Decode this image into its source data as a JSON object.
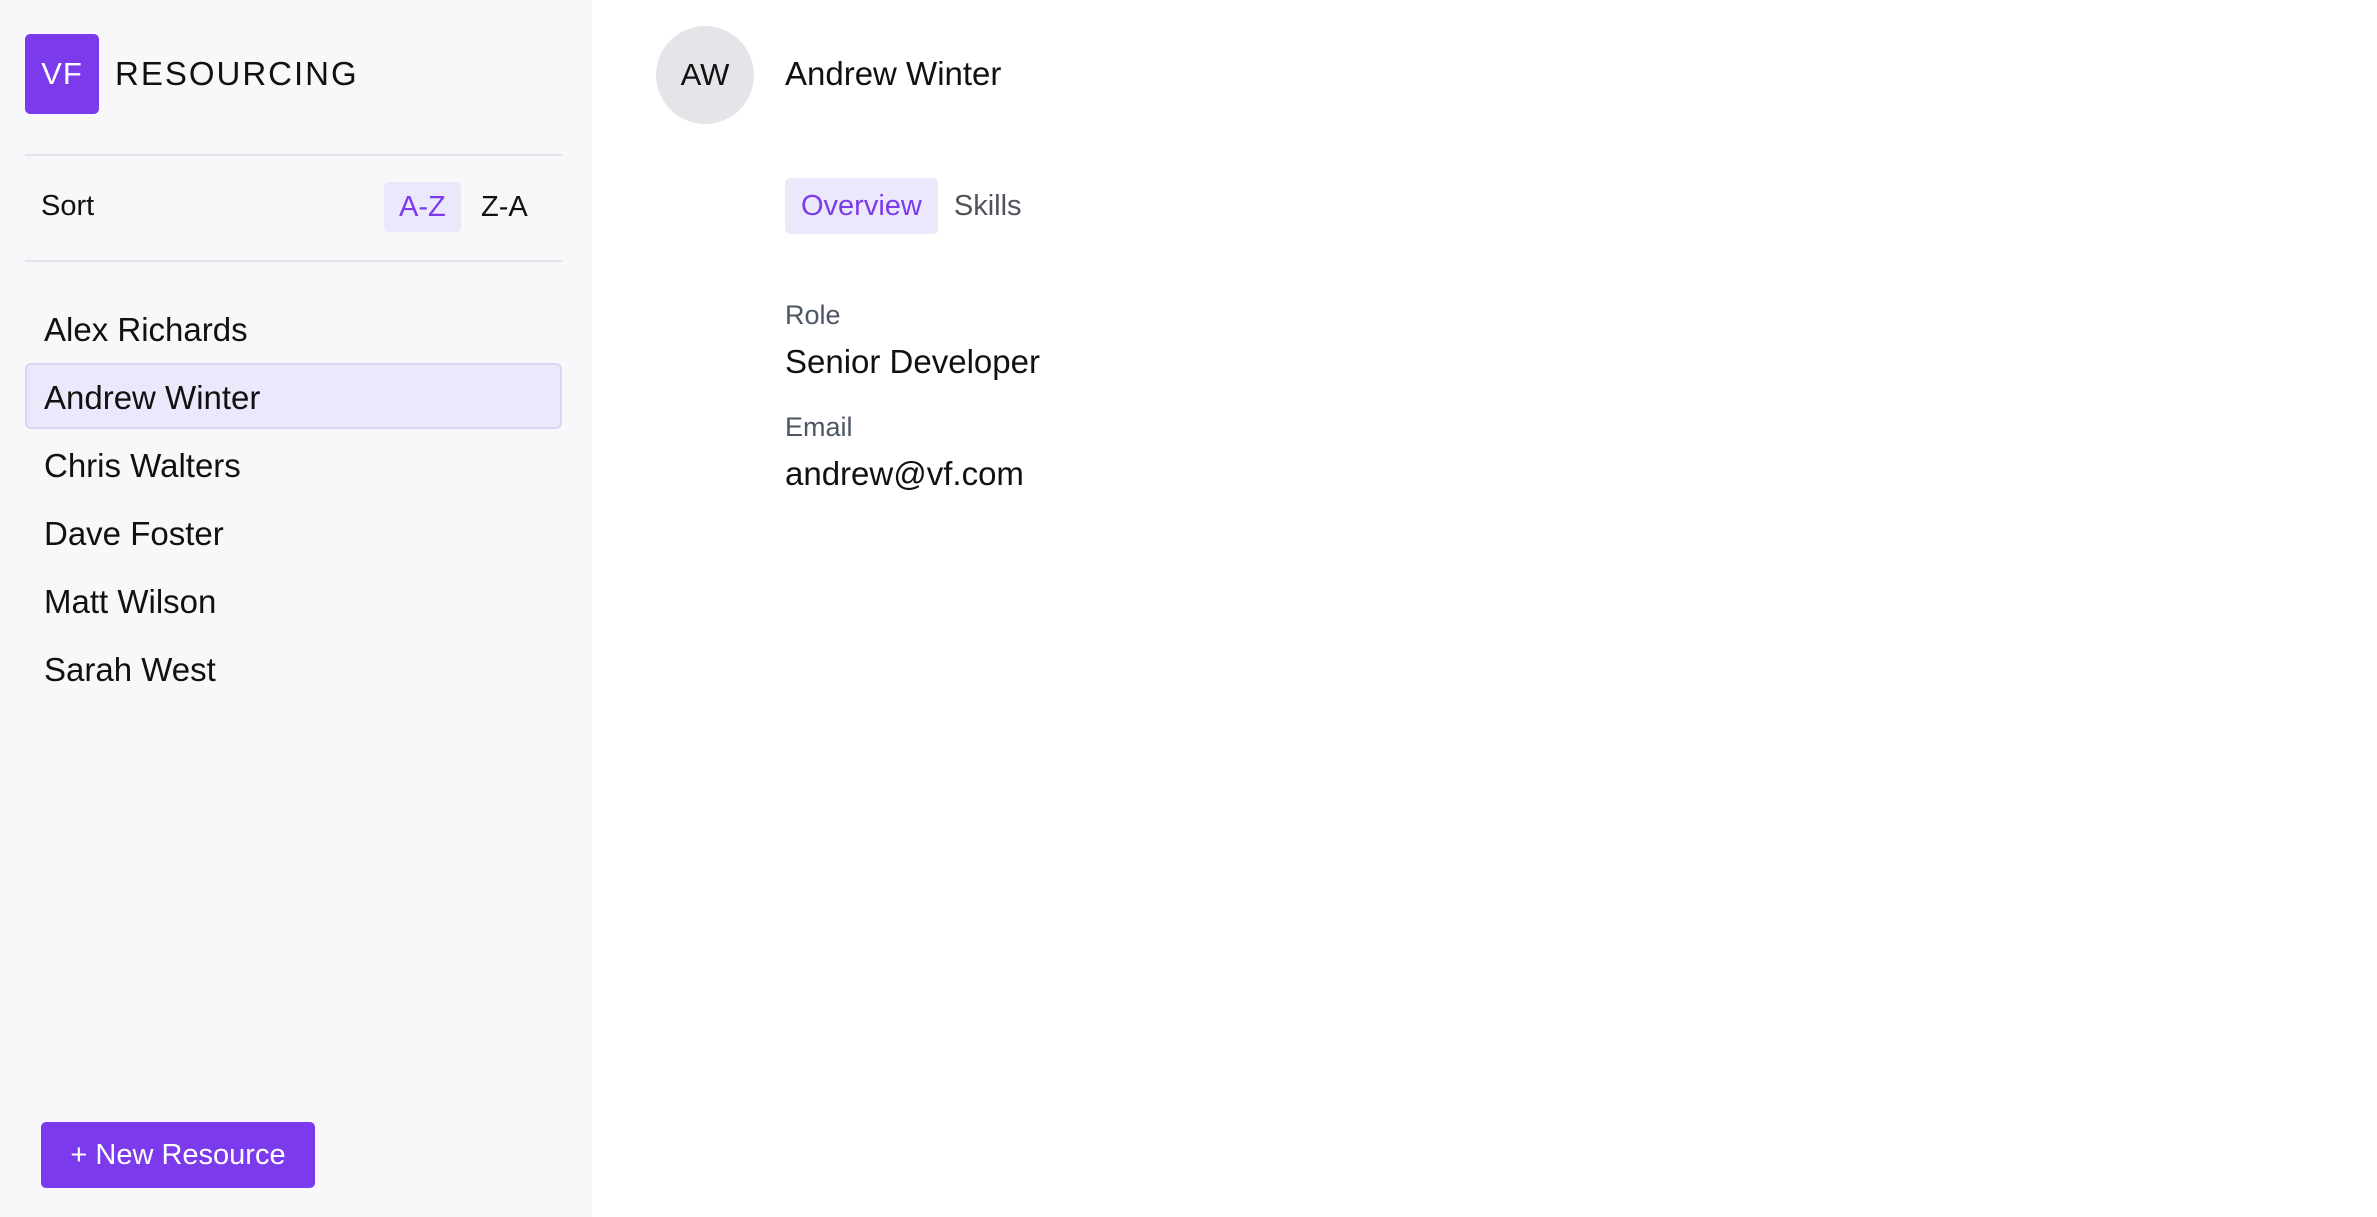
{
  "brand": {
    "logo_text": "VF",
    "title": "RESOURCING",
    "accent_color": "#7c3aed"
  },
  "sort": {
    "label": "Sort",
    "options": [
      "A-Z",
      "Z-A"
    ],
    "selected": "A-Z"
  },
  "resources": [
    {
      "name": "Alex Richards",
      "selected": false
    },
    {
      "name": "Andrew Winter",
      "selected": true
    },
    {
      "name": "Chris Walters",
      "selected": false
    },
    {
      "name": "Dave Foster",
      "selected": false
    },
    {
      "name": "Matt Wilson",
      "selected": false
    },
    {
      "name": "Sarah West",
      "selected": false
    }
  ],
  "new_button": {
    "label": "+ New Resource"
  },
  "detail": {
    "avatar_initials": "AW",
    "name": "Andrew Winter",
    "tabs": [
      {
        "label": "Overview",
        "active": true
      },
      {
        "label": "Skills",
        "active": false
      }
    ],
    "fields": {
      "role_label": "Role",
      "role_value": "Senior Developer",
      "email_label": "Email",
      "email_value": "andrew@vf.com"
    }
  }
}
